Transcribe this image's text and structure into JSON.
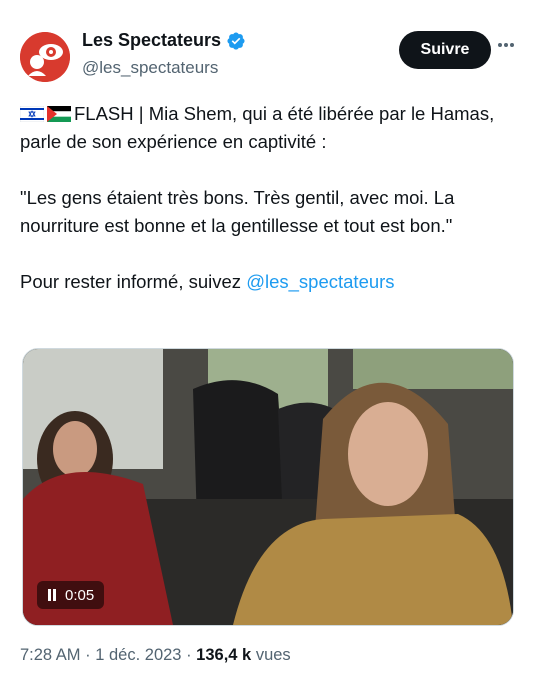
{
  "author": {
    "name": "Les Spectateurs",
    "handle": "@les_spectateurs",
    "verified": true,
    "avatar_icon": "eye-logo-icon"
  },
  "actions": {
    "follow_label": "Suivre",
    "more_icon": "more-dots-icon"
  },
  "tweet": {
    "line1_rest": "FLASH | Mia Shem, qui a été libérée par le Hamas, parle de son expérience en captivité :",
    "quote": "\"Les gens étaient très bons. Très gentil, avec moi. La nourriture est bonne et la gentillesse et tout est bon.\"",
    "cta_text": "Pour rester informé, suivez ",
    "cta_link": "@les_spectateurs",
    "flags": [
      "israel-flag-icon",
      "palestine-flag-icon"
    ]
  },
  "media": {
    "type": "video",
    "state_icon": "pause-icon",
    "time": "0:05"
  },
  "meta": {
    "time": "7:28 AM",
    "sep": "·",
    "date": "1 déc. 2023",
    "views_count": "136,4 k",
    "views_label": "vues"
  },
  "colors": {
    "text": "#0f1419",
    "secondary": "#536471",
    "link": "#1d9bf0",
    "brand_red": "#d83a2e"
  }
}
